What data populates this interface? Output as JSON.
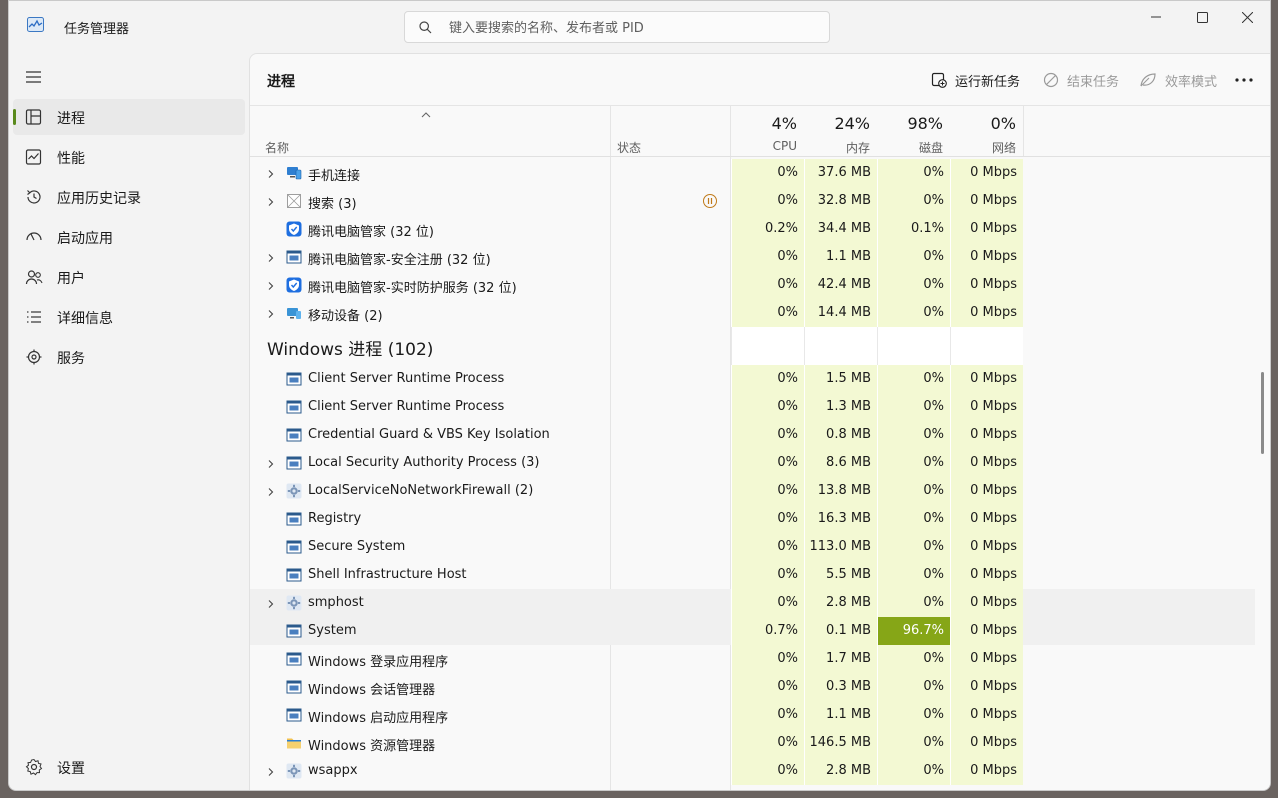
{
  "app": {
    "title": "任务管理器"
  },
  "search": {
    "placeholder": "键入要搜索的名称、发布者或 PID"
  },
  "nav": {
    "items": [
      {
        "label": "进程",
        "icon": "processes-icon",
        "active": true
      },
      {
        "label": "性能",
        "icon": "performance-icon"
      },
      {
        "label": "应用历史记录",
        "icon": "app-history-icon"
      },
      {
        "label": "启动应用",
        "icon": "startup-apps-icon"
      },
      {
        "label": "用户",
        "icon": "users-icon"
      },
      {
        "label": "详细信息",
        "icon": "details-icon"
      },
      {
        "label": "服务",
        "icon": "services-icon"
      }
    ],
    "settings": "设置"
  },
  "toolbar": {
    "title": "进程",
    "run_new_task": "运行新任务",
    "end_task": "结束任务",
    "efficiency_mode": "效率模式"
  },
  "columns": {
    "name": "名称",
    "status": "状态",
    "cpu": {
      "pct": "4%",
      "label": "CPU"
    },
    "memory": {
      "pct": "24%",
      "label": "内存"
    },
    "disk": {
      "pct": "98%",
      "label": "磁盘"
    },
    "network": {
      "pct": "0%",
      "label": "网络"
    }
  },
  "apps_rows": [
    {
      "name": "手机连接",
      "expand": true,
      "icon": "phone-link-icon",
      "cpu": "0%",
      "mem": "37.6 MB",
      "disk": "0%",
      "net": "0 Mbps"
    },
    {
      "name": "搜索 (3)",
      "expand": true,
      "icon": "search-app-icon",
      "status": "paused",
      "cpu": "0%",
      "mem": "32.8 MB",
      "disk": "0%",
      "net": "0 Mbps"
    },
    {
      "name": "腾讯电脑管家 (32 位)",
      "expand": false,
      "icon": "tencent-shield-icon",
      "cpu": "0.2%",
      "mem": "34.4 MB",
      "disk": "0.1%",
      "net": "0 Mbps"
    },
    {
      "name": "腾讯电脑管家-安全注册 (32 位)",
      "expand": true,
      "icon": "window-app-icon",
      "cpu": "0%",
      "mem": "1.1 MB",
      "disk": "0%",
      "net": "0 Mbps"
    },
    {
      "name": "腾讯电脑管家-实时防护服务 (32 位)",
      "expand": true,
      "icon": "tencent-shield-icon",
      "cpu": "0%",
      "mem": "42.4 MB",
      "disk": "0%",
      "net": "0 Mbps"
    },
    {
      "name": "移动设备 (2)",
      "expand": true,
      "icon": "mobile-devices-icon",
      "cpu": "0%",
      "mem": "14.4 MB",
      "disk": "0%",
      "net": "0 Mbps"
    }
  ],
  "group": {
    "label": "Windows 进程 (102)"
  },
  "windows_rows": [
    {
      "name": "Client Server Runtime Process",
      "expand": false,
      "icon": "window-app-icon",
      "cpu": "0%",
      "mem": "1.5 MB",
      "disk": "0%",
      "net": "0 Mbps"
    },
    {
      "name": "Client Server Runtime Process",
      "expand": false,
      "icon": "window-app-icon",
      "cpu": "0%",
      "mem": "1.3 MB",
      "disk": "0%",
      "net": "0 Mbps"
    },
    {
      "name": "Credential Guard & VBS Key Isolation",
      "expand": false,
      "icon": "window-app-icon",
      "cpu": "0%",
      "mem": "0.8 MB",
      "disk": "0%",
      "net": "0 Mbps"
    },
    {
      "name": "Local Security Authority Process (3)",
      "expand": true,
      "icon": "window-app-icon",
      "cpu": "0%",
      "mem": "8.6 MB",
      "disk": "0%",
      "net": "0 Mbps"
    },
    {
      "name": "LocalServiceNoNetworkFirewall (2)",
      "expand": true,
      "icon": "service-gear-icon",
      "cpu": "0%",
      "mem": "13.8 MB",
      "disk": "0%",
      "net": "0 Mbps"
    },
    {
      "name": "Registry",
      "expand": false,
      "icon": "window-app-icon",
      "cpu": "0%",
      "mem": "16.3 MB",
      "disk": "0%",
      "net": "0 Mbps"
    },
    {
      "name": "Secure System",
      "expand": false,
      "icon": "window-app-icon",
      "cpu": "0%",
      "mem": "113.0 MB",
      "disk": "0%",
      "net": "0 Mbps"
    },
    {
      "name": "Shell Infrastructure Host",
      "expand": false,
      "icon": "window-app-icon",
      "cpu": "0%",
      "mem": "5.5 MB",
      "disk": "0%",
      "net": "0 Mbps"
    },
    {
      "name": "smphost",
      "expand": true,
      "icon": "service-gear-icon",
      "hl": true,
      "cpu": "0%",
      "mem": "2.8 MB",
      "disk": "0%",
      "net": "0 Mbps"
    },
    {
      "name": "System",
      "expand": false,
      "icon": "window-app-icon",
      "hl": true,
      "cpu": "0.7%",
      "mem": "0.1 MB",
      "disk": "96.7%",
      "disk_hot": true,
      "net": "0 Mbps"
    },
    {
      "name": "Windows 登录应用程序",
      "expand": false,
      "icon": "window-app-icon",
      "cpu": "0%",
      "mem": "1.7 MB",
      "disk": "0%",
      "net": "0 Mbps"
    },
    {
      "name": "Windows 会话管理器",
      "expand": false,
      "icon": "window-app-icon",
      "cpu": "0%",
      "mem": "0.3 MB",
      "disk": "0%",
      "net": "0 Mbps"
    },
    {
      "name": "Windows 启动应用程序",
      "expand": false,
      "icon": "window-app-icon",
      "cpu": "0%",
      "mem": "1.1 MB",
      "disk": "0%",
      "net": "0 Mbps"
    },
    {
      "name": "Windows 资源管理器",
      "expand": false,
      "icon": "folder-icon",
      "cpu": "0%",
      "mem": "146.5 MB",
      "disk": "0%",
      "net": "0 Mbps"
    },
    {
      "name": "wsappx",
      "expand": true,
      "icon": "service-gear-icon",
      "cpu": "0%",
      "mem": "2.8 MB",
      "disk": "0%",
      "net": "0 Mbps"
    }
  ]
}
